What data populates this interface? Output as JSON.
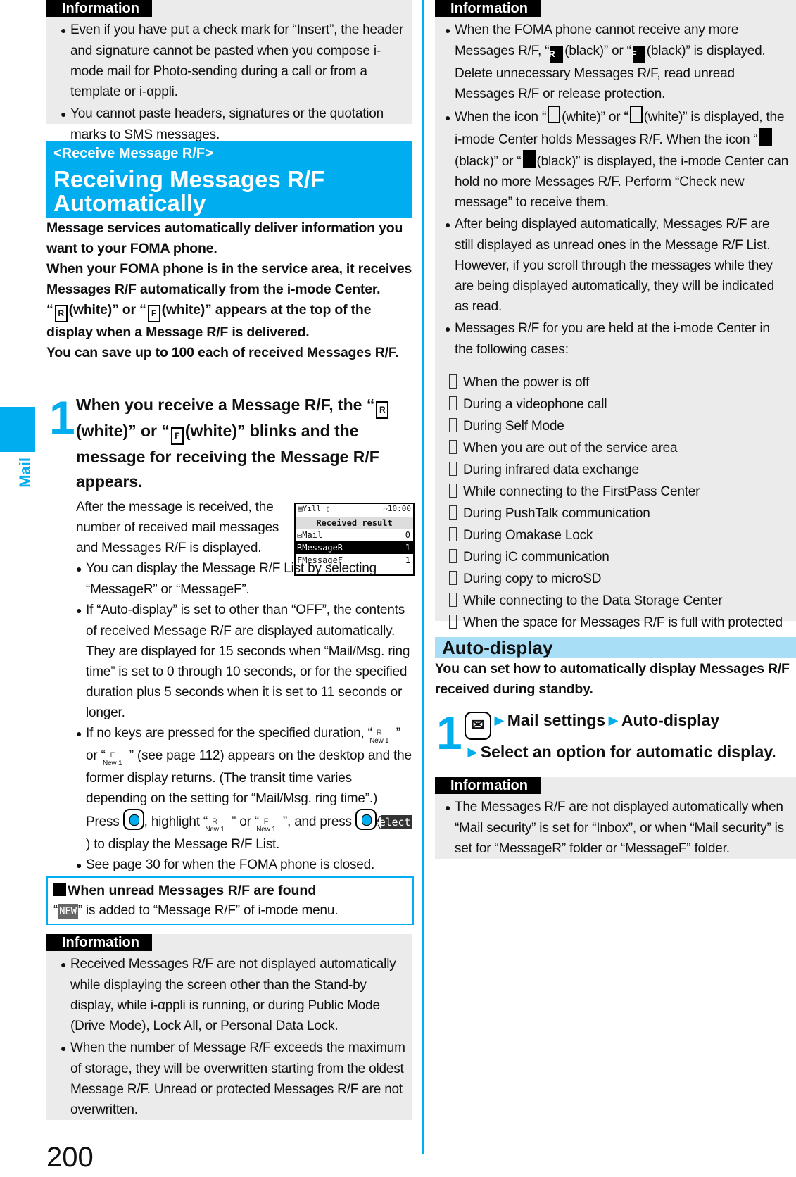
{
  "side": {
    "section_label": "Mail"
  },
  "page_number": "200",
  "left": {
    "info1": {
      "tag": "Information",
      "items": [
        "Even if you have put a check mark for “Insert”, the header and signature cannot be pasted when you compose i-mode mail for Photo-sending during a call or from a template or i-αppli.",
        "You cannot paste headers, signatures or the quotation marks to SMS messages."
      ]
    },
    "title": {
      "sub": "<Receive Message R/F>",
      "main": "Receiving Messages R/F Automatically"
    },
    "intro": {
      "p1": "Message services automatically deliver information you want to your FOMA phone.",
      "p2": "When your FOMA phone is in the service area, it receives Messages R/F automatically from the i-mode Center.",
      "p3_icon1": "R",
      "p3_a": "(white)” or “",
      "p3_icon2": "F",
      "p3_b": "(white)” appears at the top of the display when a Message R/F is delivered.",
      "p4": "You can save up to 100 each of received Messages R/F."
    },
    "step1": {
      "num": "1",
      "line_a": "When you receive a Message R/F, the “",
      "icon1": "R",
      "line_b": "(white)” or “",
      "icon2": "F",
      "line_c": "(white)” blinks and the message for receiving the Message R/F appears.",
      "desc": "After the message is received, the number of received mail messages and Messages R/F is displayed.",
      "bullets": {
        "b1": "You can display the Message R/F List by selecting “MessageR” or “MessageF”.",
        "b2": "If “Auto-display” is set to other than “OFF”, the contents of received Message R/F are displayed automatically. They are displayed for 15 seconds when “Mail/Msg. ring time” is set to 0 through 10 seconds, or for the specified duration plus 5 seconds when it is set to 11 seconds or longer.",
        "b3_a": "If no keys are pressed for the specified duration, “",
        "b3_b": "” or “",
        "b3_c": "” (see page 112) appears on the desktop and the former display returns. (The transit time varies depending on the setting for “Mail/Msg. ring time”.) Press ",
        "b3_d": ", highlight “",
        "b3_e": "” or “",
        "b3_f": "”, and press ",
        "b3_g": "(",
        "b3_h": ") to display the Message R/F List.",
        "softkey": "Select",
        "new_label": "New 1",
        "icon_r": "R",
        "icon_f": "F",
        "b4": "See page 30 for when the FOMA phone is closed."
      }
    },
    "screen": {
      "status_left": "▤Yıll ▯",
      "status_right": "▱10:00",
      "header": "Received result",
      "rows": [
        {
          "icon": "✉",
          "label": "Mail",
          "count": "0",
          "selected": false
        },
        {
          "icon": "R",
          "label": "MessageR",
          "count": "1",
          "selected": true
        },
        {
          "icon": "F",
          "label": "MessageF",
          "count": "1",
          "selected": false
        }
      ]
    },
    "unread": {
      "heading": "When unread Messages R/F are found",
      "text_a": "“",
      "badge": "NEW",
      "text_b": "” is added to “Message R/F” of i-mode menu."
    },
    "info2": {
      "tag": "Information",
      "items": [
        "Received Messages R/F are not displayed automatically while displaying the screen other than the Stand-by display, while i-αppli is running, or during Public Mode (Drive Mode), Lock All, or Personal Data Lock.",
        "When the number of Message R/F exceeds the maximum of storage, they will be overwritten starting from the oldest Message R/F. Unread or protected Messages R/F are not overwritten."
      ]
    }
  },
  "right": {
    "info1": {
      "tag": "Information",
      "i1_a": "When the FOMA phone cannot receive any more Messages R/F, “",
      "i1_icon1": "R",
      "i1_b": "(black)” or “",
      "i1_icon2": "F",
      "i1_c": "(black)” is displayed. Delete unnecessary Messages R/F, read unread Messages R/F or release protection.",
      "i2_a": "When the icon “",
      "i2_b": "(white)” or “",
      "i2_c": "(white)” is displayed, the i-mode Center holds Messages R/F. When the icon “",
      "i2_d": "(black)” or “",
      "i2_e": "(black)” is displayed, the i-mode Center can hold no more Messages R/F. Perform “Check new message” to receive them.",
      "i3": "After being displayed automatically, Messages R/F are still displayed as unread ones in the Message R/F List. However, if you scroll through the messages while they are being displayed automatically, they will be indicated as read.",
      "i4": "Messages R/F for you are held at the i-mode Center in the following cases:",
      "cases": [
        "When the power is off",
        "During a videophone call",
        "During Self Mode",
        "When you are out of the service area",
        "During infrared data exchange",
        "While connecting to the FirstPass Center",
        "During PushTalk communication",
        "During Omakase Lock",
        "During iC communication",
        "During copy to microSD",
        "While connecting to the Data Storage Center",
        "When the space for Messages R/F is full with protected or unread messages"
      ]
    },
    "auto": {
      "heading": "Auto-display",
      "intro": "You can set how to automatically display Messages R/F received during standby.",
      "step_num": "1",
      "arrow": "►",
      "item1": "Mail settings",
      "item2": "Auto-display",
      "item3": "Select an option for automatic display."
    },
    "info2": {
      "tag": "Information",
      "items": [
        "The Messages R/F are not displayed automatically when “Mail security” is set for “Inbox”, or when “Mail security” is set for “MessageR” folder or “MessageF” folder."
      ]
    }
  }
}
